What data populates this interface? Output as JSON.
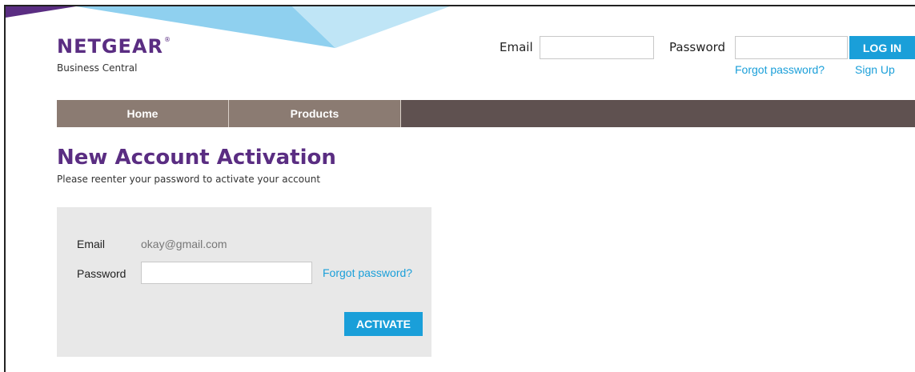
{
  "brand": {
    "name": "NETGEAR",
    "registered_mark": "®",
    "subtitle": "Business Central",
    "colors": {
      "purple": "#5a2d82",
      "accent_blue": "#1a9fd9",
      "nav_dark": "#5f5150",
      "nav_tab": "#8b7b72"
    }
  },
  "header": {
    "email_label": "Email",
    "email_value": "",
    "password_label": "Password",
    "password_value": "",
    "login_label": "LOG IN",
    "forgot_password": "Forgot password?",
    "sign_up": "Sign Up"
  },
  "nav": {
    "tabs": [
      {
        "label": "Home"
      },
      {
        "label": "Products"
      }
    ]
  },
  "page": {
    "title": "New Account Activation",
    "subtitle": "Please reenter your password to activate your account"
  },
  "activation_form": {
    "email_label": "Email",
    "email_value": "okay@gmail.com",
    "password_label": "Password",
    "password_value": "",
    "forgot_password": "Forgot password?",
    "activate_label": "ACTIVATE"
  }
}
